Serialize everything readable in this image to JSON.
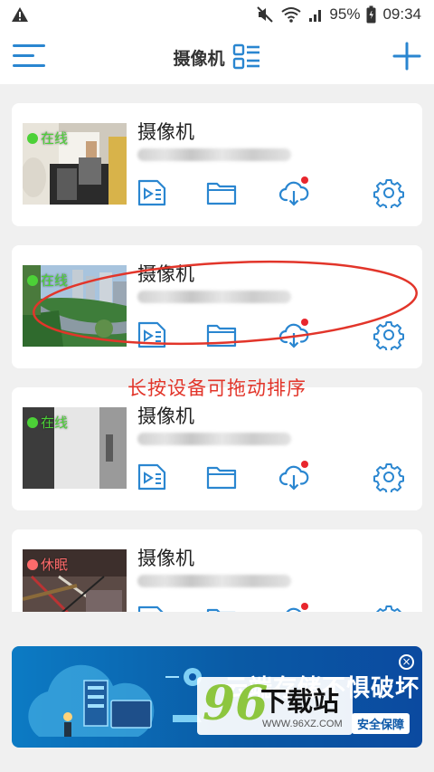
{
  "status_bar": {
    "battery": "95%",
    "time": "09:34"
  },
  "header": {
    "title": "摄像机"
  },
  "cameras": [
    {
      "name": "摄像机",
      "status": "在线",
      "status_color": "#4cd137"
    },
    {
      "name": "摄像机",
      "status": "在线",
      "status_color": "#4cd137"
    },
    {
      "name": "摄像机",
      "status": "在线",
      "status_color": "#4cd137"
    },
    {
      "name": "摄像机",
      "status": "休眠",
      "status_color": "#ff6b6b"
    }
  ],
  "hint": "长按设备可拖动排序",
  "ad": {
    "headline": "云端存储不惧破坏",
    "sub": "安全保障"
  },
  "watermark": {
    "number": "96",
    "name": "下载站",
    "url": "WWW.96XZ.COM"
  },
  "colors": {
    "accent": "#2a86d0",
    "hint": "#e2352a",
    "cloud_dot": "#e8262d"
  }
}
